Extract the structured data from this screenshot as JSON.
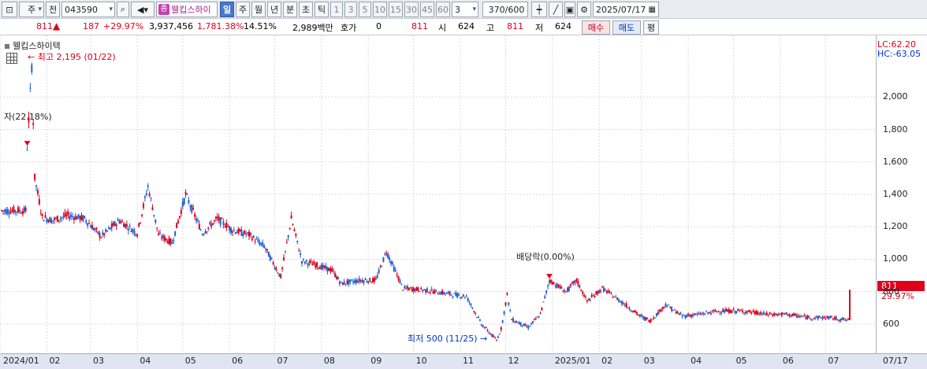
{
  "toolbar": {
    "type_label": "주",
    "prev_label": "전",
    "code": "043590",
    "name_badge": "종",
    "name": "웰킵스하이",
    "periods": [
      "일",
      "주",
      "월",
      "년",
      "분",
      "초",
      "틱"
    ],
    "active_period": "일",
    "minutes": [
      "1",
      "3",
      "5",
      "10",
      "15",
      "30",
      "45",
      "60"
    ],
    "unit_value": "3",
    "count": "370/600",
    "date": "2025/07/17"
  },
  "quote": {
    "price": "811",
    "change": "187",
    "change_pct": "+29.97%",
    "volume": "3,937,456",
    "volume_pct": "1,781.38%",
    "turnover": "14.51%",
    "amount": "2,989백만",
    "hoga_label": "호가",
    "hoga_value": "0",
    "hoga_price": "811",
    "open_label": "시",
    "open_value": "624",
    "high_label": "고",
    "high_value": "811",
    "low_label": "저",
    "low_value": "624",
    "buy_label": "매수",
    "sell_label": "매도",
    "avg_label": "평"
  },
  "chart_area": {
    "legend_name": "웰킵스하이텍",
    "lc_label": "LC:62.20",
    "hc_label": "HC:-63.05",
    "last_price_tag": "811",
    "last_pct_tag": "29.97%",
    "annotation_high": "최고 2,195 (01/22)",
    "annotation_low": "최저 500 (11/25)",
    "annotation_capital": "자(22.18%)",
    "annotation_dividend": "배당락(0.00%)",
    "x_end_label": "07/17"
  },
  "colors": {
    "up": "#e0001a",
    "down": "#1f5fd1",
    "grid": "#d6dbe3",
    "accent_name": "#a0228f"
  },
  "chart_data": {
    "type": "candlestick",
    "x_labels": [
      "2024/01",
      "02",
      "03",
      "04",
      "05",
      "06",
      "07",
      "08",
      "09",
      "10",
      "11",
      "12",
      "2025/01",
      "02",
      "03",
      "04",
      "05",
      "06",
      "07"
    ],
    "y_ticks": [
      600,
      800,
      1000,
      1200,
      1400,
      1600,
      1800,
      2000
    ],
    "ylim": [
      420,
      2380
    ],
    "grid": true,
    "close_path": [
      [
        "2024-01-02",
        1300
      ],
      [
        "2024-01-18",
        1300
      ],
      [
        "2024-01-19",
        1690
      ],
      [
        "2024-01-22",
        2195
      ],
      [
        "2024-01-24",
        1500
      ],
      [
        "2024-01-29",
        1260
      ],
      [
        "2024-02-05",
        1240
      ],
      [
        "2024-02-15",
        1270
      ],
      [
        "2024-02-26",
        1250
      ],
      [
        "2024-03-08",
        1140
      ],
      [
        "2024-03-20",
        1240
      ],
      [
        "2024-04-01",
        1160
      ],
      [
        "2024-04-08",
        1450
      ],
      [
        "2024-04-15",
        1150
      ],
      [
        "2024-04-24",
        1100
      ],
      [
        "2024-05-03",
        1400
      ],
      [
        "2024-05-14",
        1160
      ],
      [
        "2024-05-24",
        1250
      ],
      [
        "2024-06-03",
        1180
      ],
      [
        "2024-06-14",
        1150
      ],
      [
        "2024-06-24",
        1080
      ],
      [
        "2024-07-05",
        890
      ],
      [
        "2024-07-12",
        1250
      ],
      [
        "2024-07-19",
        990
      ],
      [
        "2024-07-30",
        960
      ],
      [
        "2024-08-08",
        930
      ],
      [
        "2024-08-14",
        850
      ],
      [
        "2024-08-26",
        870
      ],
      [
        "2024-09-06",
        870
      ],
      [
        "2024-09-13",
        1050
      ],
      [
        "2024-09-24",
        820
      ],
      [
        "2024-10-08",
        810
      ],
      [
        "2024-10-22",
        790
      ],
      [
        "2024-11-05",
        770
      ],
      [
        "2024-11-15",
        600
      ],
      [
        "2024-11-25",
        500
      ],
      [
        "2024-11-28",
        570
      ],
      [
        "2024-12-02",
        780
      ],
      [
        "2024-12-05",
        630
      ],
      [
        "2024-12-16",
        580
      ],
      [
        "2024-12-24",
        660
      ],
      [
        "2024-12-30",
        870
      ],
      [
        "2025-01-10",
        800
      ],
      [
        "2025-01-17",
        870
      ],
      [
        "2025-01-24",
        740
      ],
      [
        "2025-02-03",
        820
      ],
      [
        "2025-02-14",
        750
      ],
      [
        "2025-02-28",
        650
      ],
      [
        "2025-03-07",
        620
      ],
      [
        "2025-03-17",
        720
      ],
      [
        "2025-03-28",
        650
      ],
      [
        "2025-04-08",
        660
      ],
      [
        "2025-04-21",
        680
      ],
      [
        "2025-05-07",
        680
      ],
      [
        "2025-05-23",
        660
      ],
      [
        "2025-06-05",
        660
      ],
      [
        "2025-06-20",
        640
      ],
      [
        "2025-07-03",
        640
      ],
      [
        "2025-07-16",
        624
      ],
      [
        "2025-07-17",
        811
      ]
    ]
  }
}
